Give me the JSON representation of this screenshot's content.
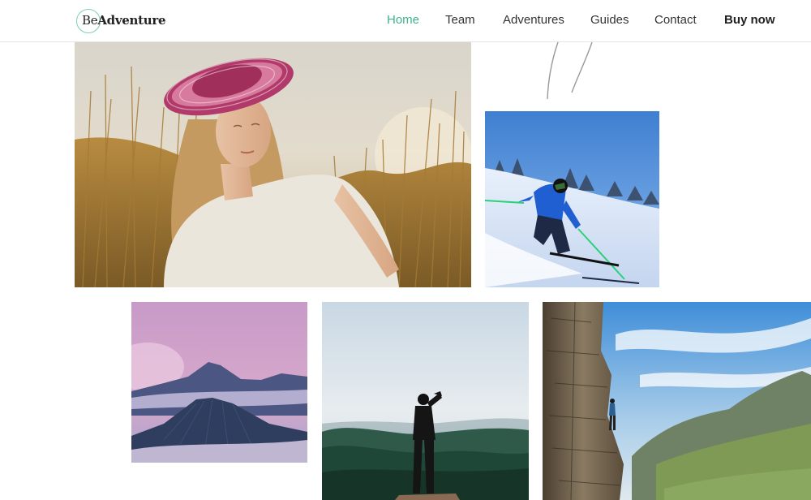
{
  "logo": {
    "prefix": "Be",
    "word": "Adventure"
  },
  "nav": {
    "home": "Home",
    "team": "Team",
    "adventures": "Adventures",
    "guides": "Guides",
    "contact": "Contact",
    "buy": "Buy now"
  },
  "colors": {
    "accent": "#3fb38a",
    "text": "#333333"
  },
  "gallery": [
    {
      "subject": "woman-in-wheat-field"
    },
    {
      "subject": "skier-on-slope"
    },
    {
      "subject": "purple-volcano"
    },
    {
      "subject": "hiker-on-summit"
    },
    {
      "subject": "climber-on-cliff"
    }
  ]
}
